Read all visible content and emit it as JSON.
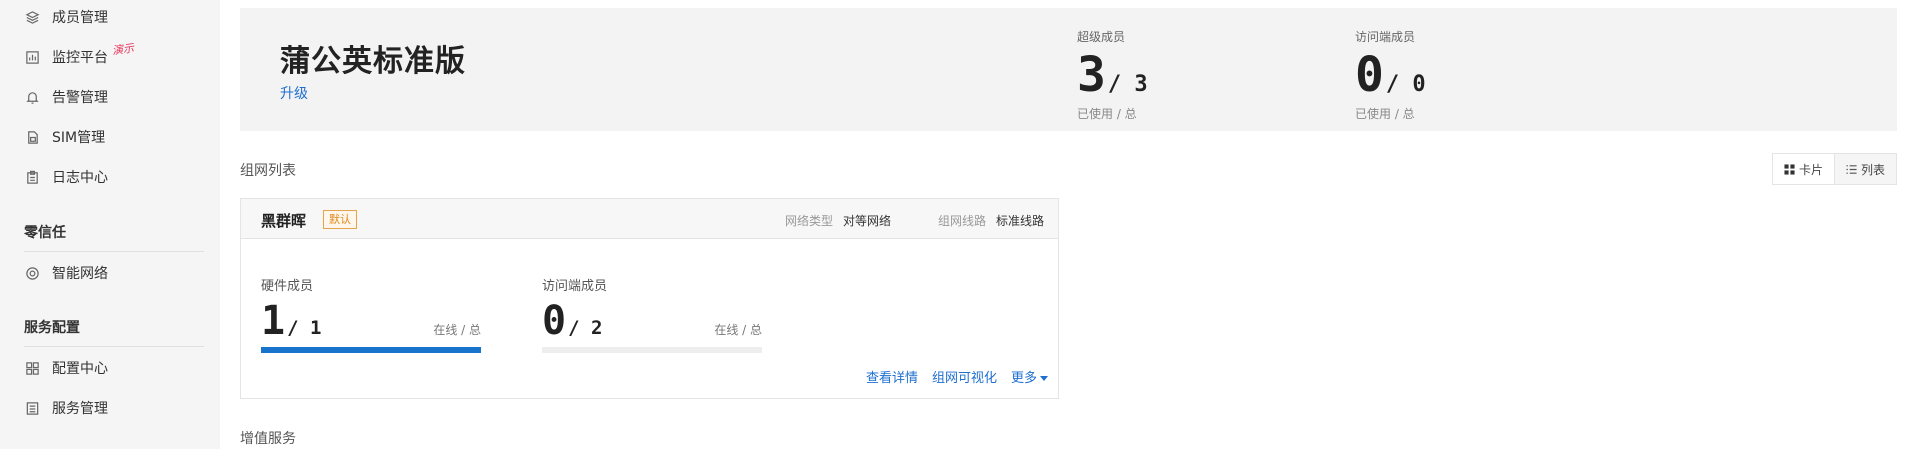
{
  "sidebar": {
    "items_top": [
      {
        "label": "成员管理",
        "icon": "layers-icon"
      },
      {
        "label": "监控平台",
        "icon": "chart-icon",
        "badge": "演示"
      },
      {
        "label": "告警管理",
        "icon": "bell-icon"
      },
      {
        "label": "SIM管理",
        "icon": "sim-icon"
      },
      {
        "label": "日志中心",
        "icon": "clipboard-icon"
      }
    ],
    "section_zero_trust": "零信任",
    "zero_trust_items": [
      {
        "label": "智能网络",
        "icon": "network-icon"
      }
    ],
    "section_service": "服务配置",
    "service_items": [
      {
        "label": "配置中心",
        "icon": "grid-icon"
      },
      {
        "label": "服务管理",
        "icon": "list-icon"
      }
    ]
  },
  "header": {
    "edition": "蒲公英标准版",
    "upgrade": "升级",
    "super_members": {
      "label": "超级成员",
      "used": "3",
      "total": "/ 3",
      "sub": "已使用 / 总"
    },
    "visitor_members": {
      "label": "访问端成员",
      "used": "0",
      "total": "/ 0",
      "sub": "已使用 / 总"
    }
  },
  "network_list": {
    "heading": "组网列表",
    "view_toggle": {
      "card": "卡片",
      "list": "列表",
      "active": "card"
    },
    "card": {
      "name": "黑群晖",
      "badge": "默认",
      "network_type_label": "网络类型",
      "network_type": "对等网络",
      "line_label": "组网线路",
      "line": "标准线路",
      "hardware": {
        "label": "硬件成员",
        "online": "1",
        "total": "/ 1",
        "sub": "在线 / 总",
        "fill": 1.0
      },
      "visitor": {
        "label": "访问端成员",
        "online": "0",
        "total": "/ 2",
        "sub": "在线 / 总",
        "fill": 0.0
      },
      "actions": {
        "details": "查看详情",
        "visualize": "组网可视化",
        "more": "更多"
      }
    }
  },
  "value_added": {
    "heading": "增值服务"
  },
  "colors": {
    "accent": "#1873cc",
    "link": "#1e6fd0",
    "badge": "#e08a1e",
    "demo": "#e8365d"
  }
}
